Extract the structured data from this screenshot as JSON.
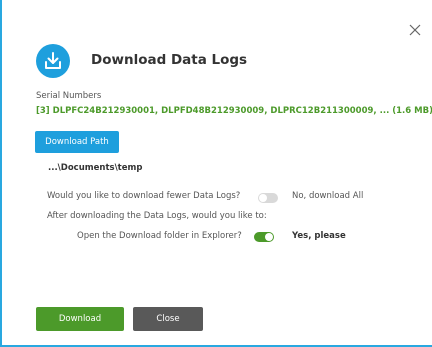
{
  "dialog": {
    "title": "Download Data Logs",
    "header_icon": "download-icon",
    "close_icon": "close-icon"
  },
  "serial": {
    "label": "Serial Numbers",
    "values": "[3] DLPFC24B212930001, DLPFD48B212930009, DLPRC12B211300009, ... (1.6 MB)"
  },
  "path": {
    "button_label": "Download Path",
    "value": "...\\Documents\\temp"
  },
  "options": {
    "fewer_logs_question": "Would you like to download fewer Data Logs?",
    "fewer_logs_toggle_on": false,
    "fewer_logs_label": "No, download All",
    "after_download_question": "After downloading the Data Logs, would you like to:",
    "open_folder_question": "Open the Download folder in Explorer?",
    "open_folder_toggle_on": true,
    "open_folder_label": "Yes, please"
  },
  "buttons": {
    "download_label": "Download",
    "close_label": "Close"
  },
  "colors": {
    "accent_blue": "#1e9fdd",
    "accent_green": "#4c9a2a",
    "close_gray": "#595959",
    "toggle_off_gray": "#d9d9d9"
  }
}
